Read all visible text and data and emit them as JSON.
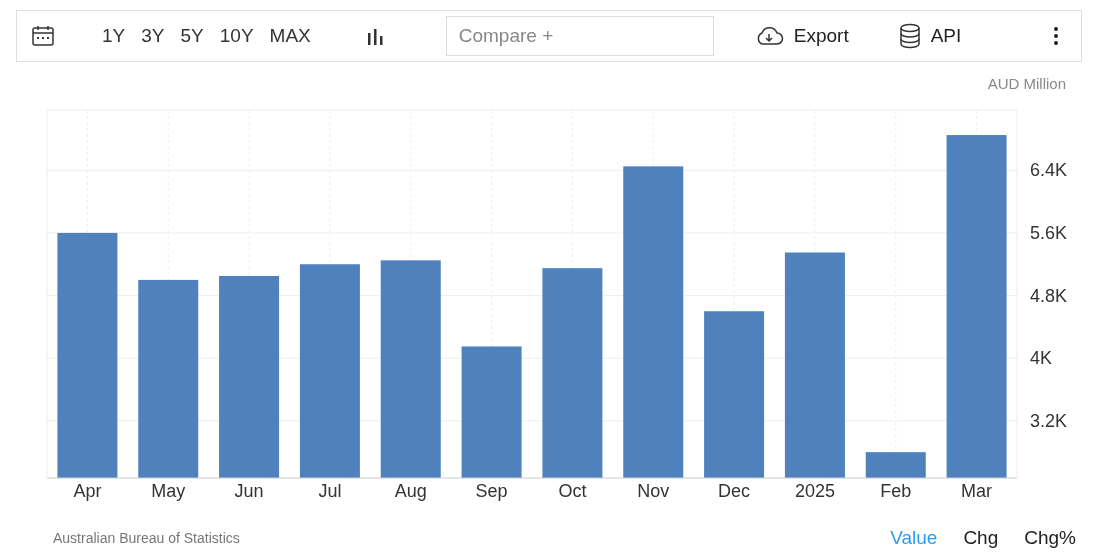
{
  "toolbar": {
    "ranges": [
      {
        "label": "1Y",
        "selected": false
      },
      {
        "label": "3Y",
        "selected": false
      },
      {
        "label": "5Y",
        "selected": false
      },
      {
        "label": "10Y",
        "selected": false
      },
      {
        "label": "MAX",
        "selected": false
      }
    ],
    "compare": {
      "placeholder": "Compare +"
    },
    "export": "Export",
    "api": "API"
  },
  "chart": {
    "chart_data": {
      "type": "bar",
      "ylabel": "AUD Million",
      "categories": [
        "Apr",
        "May",
        "Jun",
        "Jul",
        "Aug",
        "Sep",
        "Oct",
        "Nov",
        "Dec",
        "2025",
        "Feb",
        "Mar"
      ],
      "series": [
        {
          "color": "#4f81bd",
          "values": [
            5600,
            5000,
            5050,
            5200,
            5250,
            4150,
            5150,
            6450,
            4600,
            5350,
            2800,
            6850
          ]
        }
      ],
      "ylim": [
        2470,
        7170
      ],
      "grid": true,
      "yticks": [
        {
          "value": 3200,
          "label": "3.2K"
        },
        {
          "value": 4000,
          "label": "4K"
        },
        {
          "value": 4800,
          "label": "4.8K"
        },
        {
          "value": 5600,
          "label": "5.6K"
        },
        {
          "value": 6400,
          "label": "6.4K"
        }
      ]
    }
  },
  "footer": {
    "source": "Australian Bureau of Statistics",
    "tabs": [
      {
        "label": "Value",
        "selected": true
      },
      {
        "label": "Chg",
        "selected": false
      },
      {
        "label": "Chg%",
        "selected": false
      }
    ]
  }
}
